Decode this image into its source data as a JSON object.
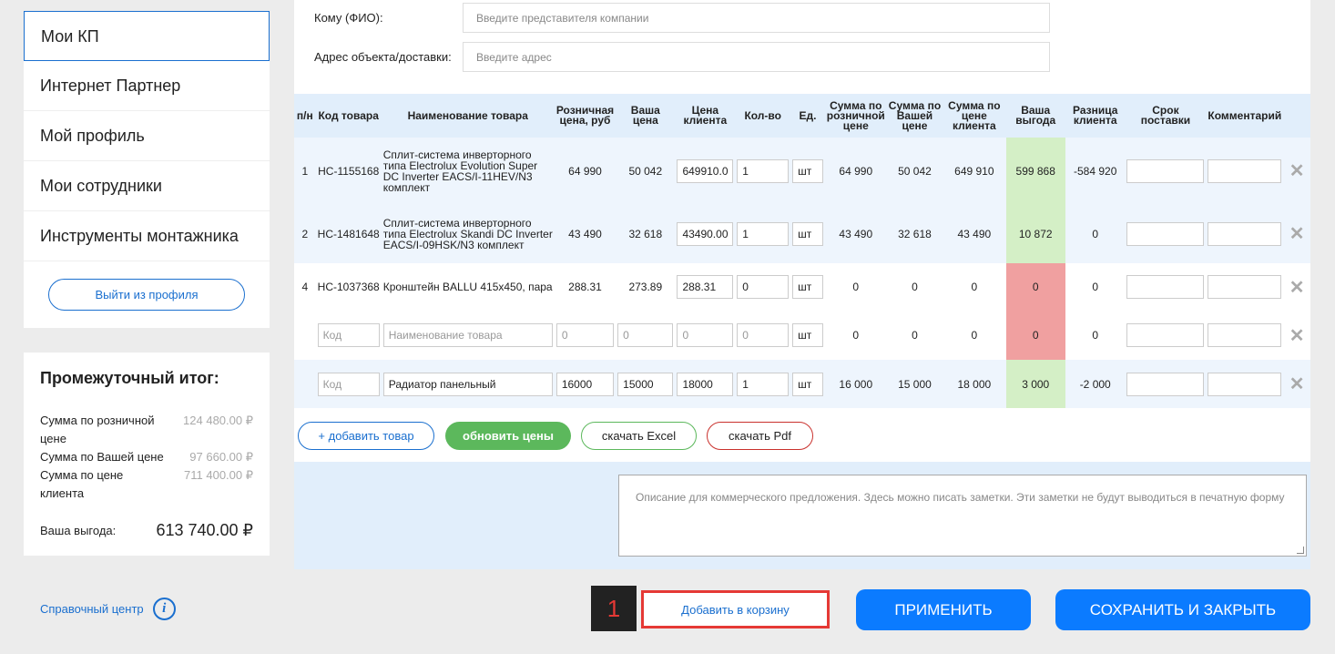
{
  "sidebar": {
    "menu": [
      "Мои КП",
      "Интернет Партнер",
      "Мой профиль",
      "Мои сотрудники",
      "Инструменты монтажника"
    ],
    "logout": "Выйти из профиля"
  },
  "subtotal": {
    "title": "Промежуточный итог:",
    "retail_label": "Сумма по розничной цене",
    "retail_value": "124 480.00 ₽",
    "your_label": "Сумма по Вашей цене",
    "your_value": "97 660.00 ₽",
    "client_label": "Сумма по цене клиента",
    "client_value": "711 400.00 ₽",
    "benefit_label": "Ваша выгода:",
    "benefit_value": "613 740.00 ₽"
  },
  "help": {
    "label": "Справочный центр",
    "icon": "i"
  },
  "form": {
    "to_label": "Кому (ФИО):",
    "to_placeholder": "Введите представителя компании",
    "address_label": "Адрес объекта/доставки:",
    "address_placeholder": "Введите адрес"
  },
  "table": {
    "headers": [
      "п/н",
      "Код товара",
      "Наименование товара",
      "Розничная цена, руб",
      "Ваша цена",
      "Цена клиента",
      "Кол-во",
      "Ед.",
      "Сумма по розничной цене",
      "Сумма по Вашей цене",
      "Сумма по цене клиента",
      "Ваша выгода",
      "Разница клиента",
      "Срок поставки",
      "Комментарий"
    ],
    "rows": [
      {
        "n": "1",
        "code": "НС-1155168",
        "name": "Сплит-система инверторного типа Electrolux Evolution Super DC Inverter EACS/I-11HEV/N3 комплект",
        "retail": "64 990",
        "your": "50 042",
        "client": "649910.0",
        "qty": "1",
        "unit": "шт",
        "sum_retail": "64 990",
        "sum_your": "50 042",
        "sum_client": "649 910",
        "benefit": "599 868",
        "diff": "-584 920"
      },
      {
        "n": "2",
        "code": "НС-1481648",
        "name": "Сплит-система инверторного типа Electrolux Skandi DC Inverter EACS/I-09HSK/N3 комплект",
        "retail": "43 490",
        "your": "32 618",
        "client": "43490.00",
        "qty": "1",
        "unit": "шт",
        "sum_retail": "43 490",
        "sum_your": "32 618",
        "sum_client": "43 490",
        "benefit": "10 872",
        "diff": "0"
      },
      {
        "n": "4",
        "code": "НС-1037368",
        "name": "Кронштейн BALLU 415x450, пара",
        "retail": "288.31",
        "your": "273.89",
        "client": "288.31",
        "qty": "0",
        "unit": "шт",
        "sum_retail": "0",
        "sum_your": "0",
        "sum_client": "0",
        "benefit": "0",
        "diff": "0"
      },
      {
        "code_ph": "Код",
        "name_ph": "Наименование товара",
        "retail": "0",
        "your": "0",
        "client": "0",
        "qty": "0",
        "unit": "шт",
        "sum_retail": "0",
        "sum_your": "0",
        "sum_client": "0",
        "benefit": "0",
        "diff": "0"
      },
      {
        "code_ph": "Код",
        "name": "Радиатор панельный",
        "retail": "16000",
        "your": "15000",
        "client": "18000",
        "qty": "1",
        "unit": "шт",
        "sum_retail": "16 000",
        "sum_your": "15 000",
        "sum_client": "18 000",
        "benefit": "3 000",
        "diff": "-2 000"
      }
    ],
    "delete_icon": "✕"
  },
  "actions": {
    "add_item": "+ добавить товар",
    "update_prices": "обновить цены",
    "download_excel": "скачать Excel",
    "download_pdf": "скачать Pdf"
  },
  "note_placeholder": "Описание для коммерческого предложения. Здесь можно писать заметки. Эти заметки не будут выводиться в печатную форму",
  "footer": {
    "step_badge": "1",
    "add_to_cart": "Добавить в корзину",
    "apply": "ПРИМЕНИТЬ",
    "save_close": "СОХРАНИТЬ И ЗАКРЫТЬ"
  },
  "colors": {
    "accent": "#1a6fcf",
    "primary_button": "#0b7bff",
    "update_button": "#5cb85c",
    "benefit_positive": "#d4efc6",
    "benefit_zero": "#f0a0a0",
    "highlight": "#e53935"
  }
}
